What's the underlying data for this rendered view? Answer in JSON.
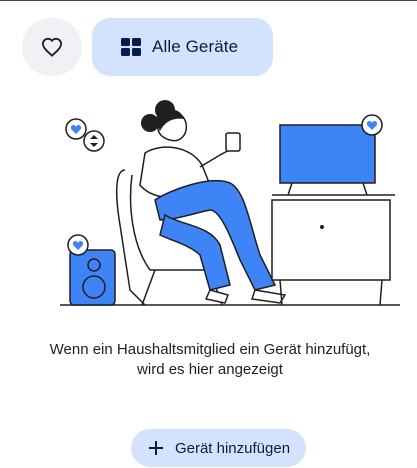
{
  "header": {
    "all_devices_label": "Alle Geräte"
  },
  "icons": {
    "favorite": "heart-outline-icon",
    "all_devices": "grid-icon",
    "add": "plus-icon"
  },
  "empty_state": {
    "line1": "Wenn ein Haushaltsmitglied ein Gerät hinzufügt,",
    "line2": "wird es hier angezeigt"
  },
  "add_button": {
    "label": "Gerät hinzufügen"
  },
  "colors": {
    "accent_blue": "#3e84f6",
    "chip_bg": "#d3e3fd",
    "chip_text": "#041e49",
    "fav_bg": "#eff1f4"
  }
}
